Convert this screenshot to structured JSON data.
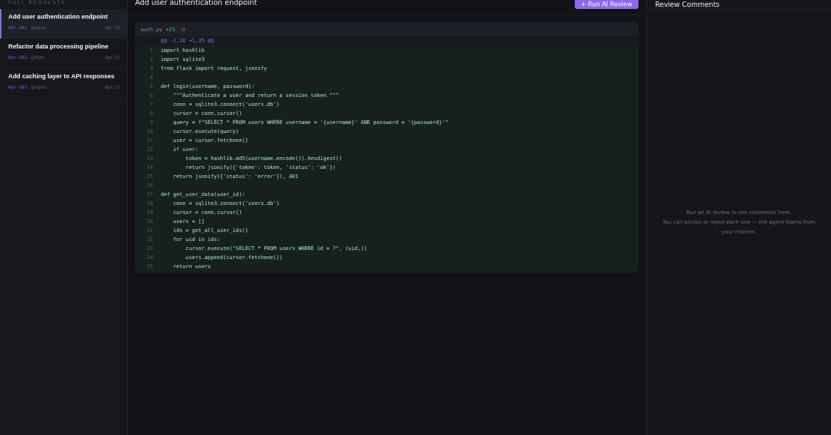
{
  "sidebar": {
    "heading": "PULL REQUESTS",
    "items": [
      {
        "title": "Add user authentication endpoint",
        "id": "#pr-001",
        "author": "@alice",
        "date": "Apr 10",
        "selected": true
      },
      {
        "title": "Refactor data processing pipeline",
        "id": "#pr-002",
        "author": "@bob",
        "date": "Apr 11",
        "selected": false
      },
      {
        "title": "Add caching layer to API responses",
        "id": "#pr-003",
        "author": "@carol",
        "date": "Apr 12",
        "selected": false
      }
    ]
  },
  "main": {
    "title": "Add user authentication endpoint",
    "run_button": "+ Run AI Review",
    "diff": {
      "file": "auth.py",
      "additions": "+25",
      "deletions": "-0",
      "hunk": "@@ -1,10 +1,35 @@",
      "lines": [
        {
          "n": "1",
          "code": "import hashlib",
          "kind": "add"
        },
        {
          "n": "2",
          "code": "import sqlite3",
          "kind": "add"
        },
        {
          "n": "3",
          "code": "from flask import request, jsonify",
          "kind": "add"
        },
        {
          "n": "4",
          "kind": "add"
        },
        {
          "n": "5",
          "code": "def login(username, password):",
          "kind": "add"
        },
        {
          "n": "6",
          "code": "    \"\"\"Authenticate a user and return a session token.\"\"\"",
          "kind": "add"
        },
        {
          "n": "7",
          "code": "    conn = sqlite3.connect('users.db')",
          "kind": "add"
        },
        {
          "n": "8",
          "code": "    cursor = conn.cursor()",
          "kind": "add"
        },
        {
          "n": "9",
          "code": "    query = f\"SELECT * FROM users WHERE username = '{username}' AND password = '{password}'\"",
          "kind": "add"
        },
        {
          "n": "10",
          "code": "    cursor.execute(query)",
          "kind": "add"
        },
        {
          "n": "11",
          "code": "    user = cursor.fetchone()",
          "kind": "add"
        },
        {
          "n": "12",
          "code": "    if user:",
          "kind": "add"
        },
        {
          "n": "13",
          "code": "        token = hashlib.md5(username.encode()).hexdigest()",
          "kind": "add"
        },
        {
          "n": "14",
          "code": "        return jsonify({'token': token, 'status': 'ok'})",
          "kind": "add"
        },
        {
          "n": "15",
          "code": "    return jsonify({'status': 'error'}), 401",
          "kind": "add"
        },
        {
          "n": "16",
          "kind": "add"
        },
        {
          "n": "17",
          "code": "def get_user_data(user_id):",
          "kind": "add"
        },
        {
          "n": "18",
          "code": "    conn = sqlite3.connect('users.db')",
          "kind": "add"
        },
        {
          "n": "19",
          "code": "    cursor = conn.cursor()",
          "kind": "add"
        },
        {
          "n": "20",
          "code": "    users = []",
          "kind": "add"
        },
        {
          "n": "21",
          "code": "    ids = get_all_user_ids()",
          "kind": "add"
        },
        {
          "n": "22",
          "code": "    for uid in ids:",
          "kind": "add"
        },
        {
          "n": "23",
          "code": "        cursor.execute(\"SELECT * FROM users WHERE id = ?\", (uid,))",
          "kind": "add"
        },
        {
          "n": "24",
          "code": "        users.append(cursor.fetchone())",
          "kind": "add"
        },
        {
          "n": "25",
          "code": "    return users",
          "kind": "add"
        }
      ]
    }
  },
  "review": {
    "title": "Review Comments",
    "empty": "Run an AI review to see comments here.\nYou can accept or reject each one — the agent learns from your choices."
  }
}
